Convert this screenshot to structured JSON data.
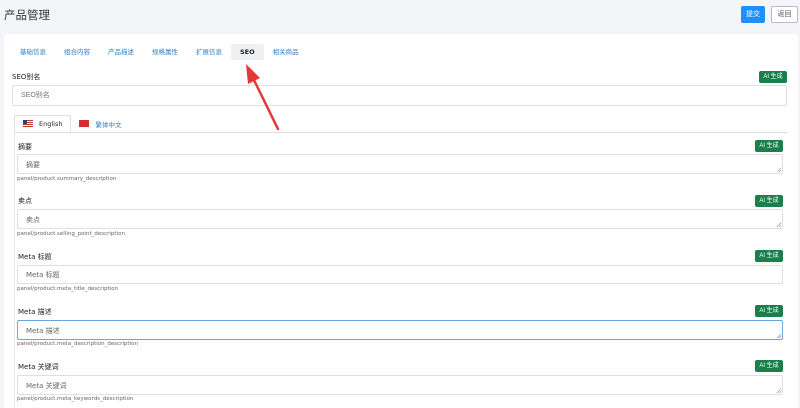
{
  "header": {
    "title": "产品管理",
    "submit_label": "提交",
    "back_label": "返回"
  },
  "tabs": [
    {
      "label": "基础信息",
      "active": false
    },
    {
      "label": "组合内容",
      "active": false
    },
    {
      "label": "产品描述",
      "active": false
    },
    {
      "label": "规格属性",
      "active": false
    },
    {
      "label": "扩展信息",
      "active": false
    },
    {
      "label": "SEO",
      "active": true
    },
    {
      "label": "相关商品",
      "active": false
    }
  ],
  "seo_alias": {
    "label": "SEO别名",
    "placeholder": "SEO别名",
    "ai_label": "AI 生成"
  },
  "languages": [
    {
      "label": "English",
      "active": true
    },
    {
      "label": "繁体中文",
      "active": false
    }
  ],
  "fields": {
    "summary": {
      "label": "摘要",
      "placeholder": "摘要",
      "hint": "panel/product.summary_description",
      "ai_label": "AI 生成"
    },
    "selling_point": {
      "label": "卖点",
      "placeholder": "卖点",
      "hint": "panel/product.selling_point_description",
      "ai_label": "AI 生成"
    },
    "meta_title": {
      "label": "Meta 标题",
      "placeholder": "Meta 标题",
      "hint": "panel/product.meta_title_description",
      "ai_label": "AI 生成"
    },
    "meta_description": {
      "label": "Meta 描述",
      "placeholder": "Meta 描述",
      "hint": "panel/product.meta_description_description",
      "ai_label": "AI 生成"
    },
    "meta_keywords": {
      "label": "Meta 关键词",
      "placeholder": "Meta 关键词",
      "hint": "panel/product.meta_keywords_description",
      "ai_label": "AI 生成"
    }
  },
  "colors": {
    "primary": "#1e8fff",
    "ai_button": "#1a7f4b",
    "tab_link": "#2d7fc4",
    "arrow": "#e53935"
  },
  "icons": {
    "flag_english": "us-flag-icon",
    "flag_chinese": "cn-flag-icon",
    "annotation_arrow": "red-arrow-icon"
  }
}
